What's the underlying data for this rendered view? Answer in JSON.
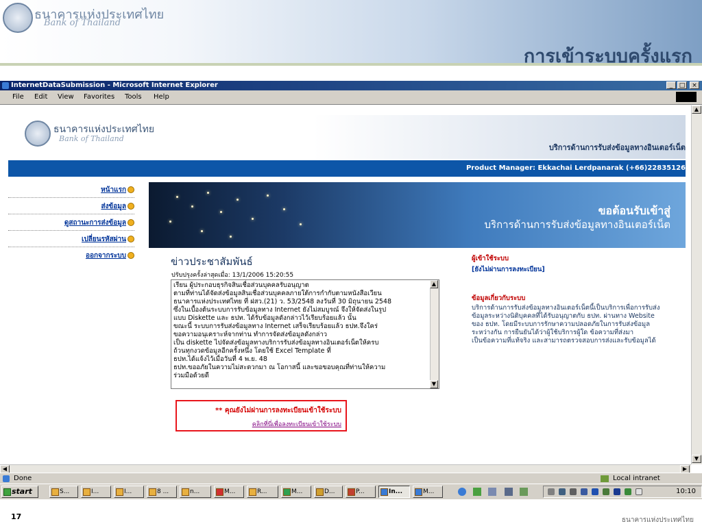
{
  "slide": {
    "brand_th": "ธนาคารแห่งประเทศไทย",
    "brand_en": "Bank of Thailand",
    "title": "การเข้าระบบครั้งแรก",
    "number": "17",
    "footer": "ธนาคารแห่งประเทศไทย"
  },
  "browser": {
    "title": "InternetDataSubmission - Microsoft Internet Explorer",
    "menu": [
      "File",
      "Edit",
      "View",
      "Favorites",
      "Tools",
      "Help"
    ],
    "status": "Done",
    "zone": "Local intranet"
  },
  "page": {
    "brand_th": "ธนาคารแห่งประเทศไทย",
    "brand_en": "Bank of Thailand",
    "service": "บริการด้านการรับส่งข้อมูลทางอินเตอร์เน็ต",
    "manager": "Product Manager: Ekkachai Lerdpanarak (+66)22835126",
    "nav": [
      "หน้าแรก",
      "ส่งข้อมูล",
      "ดูสถานะการส่งข้อมูล",
      "เปลี่ยนรหัสผ่าน",
      "ออกจากระบบ"
    ],
    "hero_welcome": "ขอต้อนรับเข้าสู่",
    "hero_service": "บริการด้านการรับส่งข้อมูลทางอินเตอร์เน็ต",
    "news_heading": "ข่าวประชาสัมพันธ์",
    "news_updated": "ปรับปรุงครั้งล่าสุดเมื่อ: 13/1/2006 15:20:55",
    "news_lines": [
      "เรียน ผู้ประกอบธุรกิจสินเชื่อส่วนบุคคลรับอนุญาต",
      "        ตามที่ท่านได้จัดส่งข้อมูลสินเชื่อส่วนบุคคลภายใต้การกำกับตามหนังสือเวียน",
      "ธนาคารแห่งประเทศไทย ที่ ฝสว.(21) ว. 53/2548  ลงวันที่ 30 มิถุนายน 2548",
      "ซึ่งในเบื้องต้นระบบการรับข้อมูลทาง Internet ยังไม่สมบูรณ์ จึงให้จัดส่งในรูป",
      "แบบ Diskette และ ธปท. ได้รับข้อมูลดังกล่าวไว้เรียบร้อยแล้ว นั้น",
      "        ขณะนี้ ระบบการรับส่งข้อมูลทาง Internet เสร็จเรียบร้อยแล้ว ธปท.จึงใคร่",
      "ขอความอนุเคราะห์จากท่าน ทำการจัดส่งข้อมูลดังกล่าว",
      "เป็น diskette ไปจัดส่งข้อมูลทางบริการรับส่งข้อมูลทางอินเตอร์เน็ตให้ครบ",
      "ถ้วนทุกงวดข้อมูลอีกครั้งหนึ่ง โดยใช้ Excel Template ที่",
      "ธปท.ได้แจ้งไว้เมื่อวันที่ 4 พ.ย. 48",
      "        ธปท.ขออภัยในความไม่สะดวกมา ณ โอกาสนี้ และขอขอบคุณที่ท่านให้ความ",
      "ร่วมมือด้วยดี"
    ],
    "login_warning": "** คุณยังไม่ผ่านการลงทะเบียนเข้าใช้ระบบ",
    "login_link": "คลิกที่นี่เพื่อลงทะเบียนเข้าใช้ระบบ",
    "right_users_title": "ผู้เข้าใช้ระบบ",
    "right_users_link": "[ยังไม่ผ่านการลงทะเบียน]",
    "right_info_title": "ข้อมูลเกี่ยวกับระบบ",
    "right_info_lines": [
      "บริการด้านการรับส่งข้อมูลทางอินเตอร์เน็ตนี้เป็นบริการเพื่อการรับส่ง",
      "ข้อมูลระหว่างนิติบุคคลที่ได้รับอนุญาตกับ ธปท. ผ่านทาง Website",
      "ของ ธปท. โดยมีระบบการรักษาความปลอดภัยในการรับส่งข้อมูล",
      "ระหว่างกัน การยืนยันได้ว่าผู้ใช้บริการผู้ใด ข้อความที่ส่งมา",
      "เป็นข้อความที่แท้จริง และสามารถตรวจสอบการส่งและรับข้อมูลได้"
    ]
  },
  "taskbar": {
    "start": "start",
    "buttons": [
      "S...",
      "I...",
      "I...",
      "8 ...",
      "n...",
      "M...",
      "R...",
      "M...",
      "D...",
      "P...",
      "In...",
      "M..."
    ],
    "active_index": 10,
    "clock": "10:10"
  }
}
